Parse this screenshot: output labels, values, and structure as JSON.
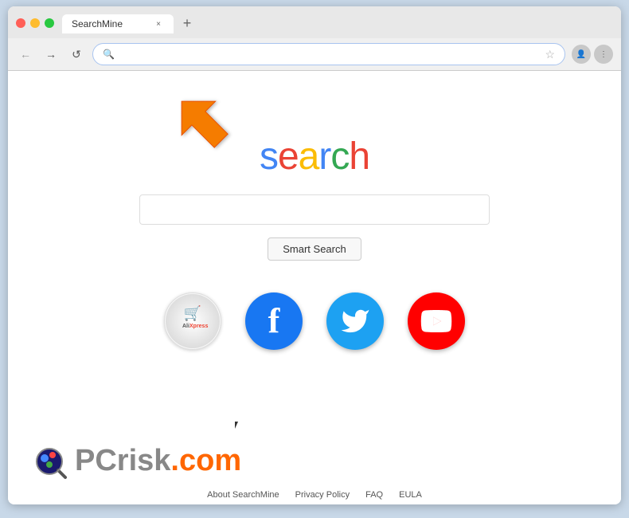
{
  "browser": {
    "tab_title": "SearchMine",
    "tab_close_label": "×",
    "new_tab_label": "+",
    "address_bar_value": "",
    "address_placeholder": ""
  },
  "nav": {
    "back_icon": "←",
    "forward_icon": "→",
    "reload_icon": "↺"
  },
  "page": {
    "search_logo": {
      "s": "s",
      "e": "e",
      "a": "a",
      "r": "r",
      "c": "c",
      "h": "h"
    },
    "search_logo_text": "search",
    "smart_search_label": "Smart Search",
    "search_input_placeholder": ""
  },
  "shortcuts": [
    {
      "name": "AliExpress",
      "type": "aliexpress"
    },
    {
      "name": "Facebook",
      "type": "facebook"
    },
    {
      "name": "Twitter",
      "type": "twitter"
    },
    {
      "name": "YouTube",
      "type": "youtube"
    }
  ],
  "footer": {
    "logo_text": "PC",
    "logo_suffix": "risk.com",
    "links": [
      {
        "label": "About SearchMine"
      },
      {
        "label": "Privacy Policy"
      },
      {
        "label": "FAQ"
      },
      {
        "label": "EULA"
      }
    ]
  }
}
